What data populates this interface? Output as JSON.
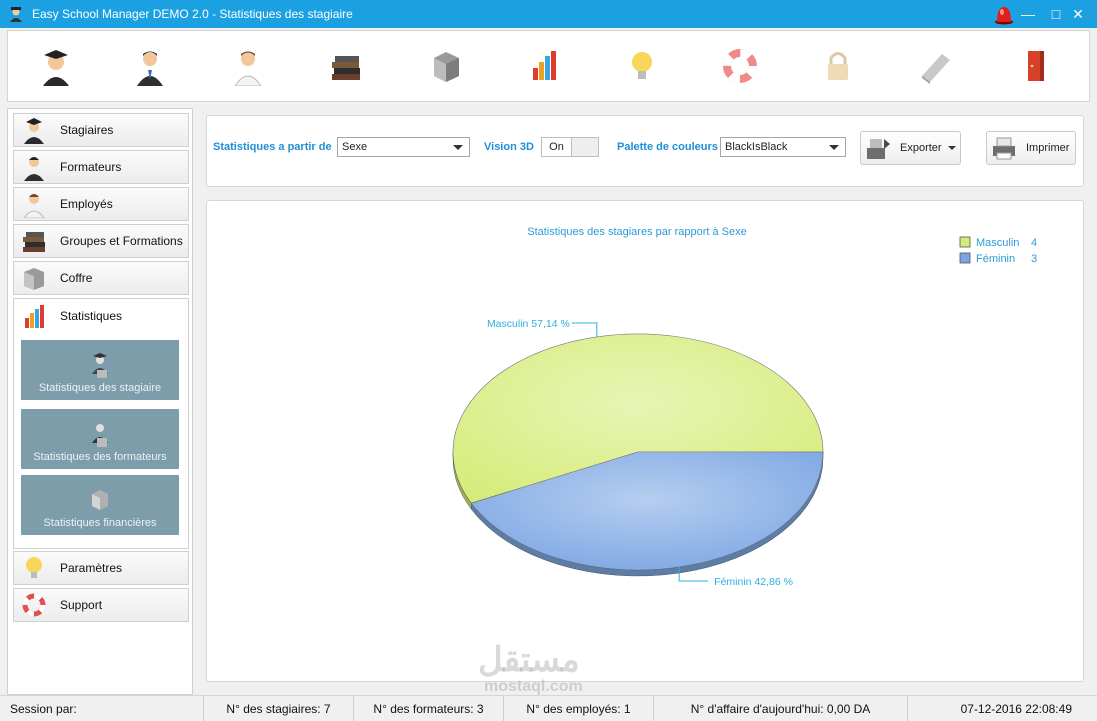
{
  "window": {
    "title": "Easy School Manager DEMO 2.0 - Statistiques des stagiaire",
    "minimize": "—",
    "maximize": "□",
    "close": "✕"
  },
  "toolbar": {
    "icons": [
      "graduate-icon",
      "teacher-icon",
      "employee-icon",
      "books-icon",
      "safe-icon",
      "chart-icon",
      "bulb-icon",
      "lifebuoy-icon",
      "lock-icon",
      "keyboard-icon",
      "exit-door-icon"
    ]
  },
  "nav": {
    "items": [
      {
        "label": "Stagiaires",
        "icon": "graduate-icon"
      },
      {
        "label": "Formateurs",
        "icon": "teacher-icon"
      },
      {
        "label": "Employés",
        "icon": "employee-icon"
      },
      {
        "label": "Groupes et Formations",
        "icon": "books-icon"
      },
      {
        "label": "Coffre",
        "icon": "safe-icon"
      },
      {
        "label": "Statistiques",
        "icon": "chart-icon"
      }
    ],
    "sub_items": [
      {
        "label": "Statistiques des stagiaire"
      },
      {
        "label": "Statistiques des formateurs"
      },
      {
        "label": "Statistiques financières"
      }
    ],
    "bottom_items": [
      {
        "label": "Paramètres",
        "icon": "bulb-icon"
      },
      {
        "label": "Support",
        "icon": "lifebuoy-icon"
      }
    ]
  },
  "filters": {
    "stats_label": "Statistiques a partir de",
    "stats_value": "Sexe",
    "vision_label": "Vision 3D",
    "vision_value": "On",
    "palette_label": "Palette de couleurs",
    "palette_value": "BlackIsBlack",
    "export_label": "Exporter",
    "print_label": "Imprimer"
  },
  "chart_data": {
    "type": "pie",
    "title": "Statistiques des stagiares par rapport à Sexe",
    "categories": [
      "Masculin",
      "Féminin"
    ],
    "values": [
      4,
      3
    ],
    "slice_labels": [
      "Masculin 57,14 %",
      "Féminin 42,86 %"
    ],
    "colors": [
      "#d6ec7a",
      "#7aa5e3"
    ],
    "three_d": true,
    "legend": "top-right"
  },
  "watermark": {
    "arabic": "مستقل",
    "latin": "mostaql.com"
  },
  "status": {
    "session": "Session par:",
    "stagiaires": "N° des stagiaires: 7",
    "formateurs": "N° des formateurs: 3",
    "employes": "N° des employés: 1",
    "affaire": "N° d'affaire d'aujourd'hui: 0,00 DA",
    "datetime": "07-12-2016 22:08:49"
  }
}
